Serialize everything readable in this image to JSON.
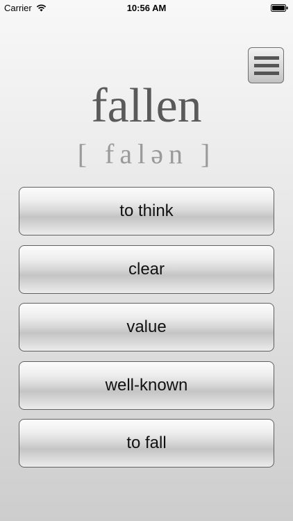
{
  "status_bar": {
    "carrier": "Carrier",
    "time": "10:56 AM",
    "wifi_icon": "wifi-icon",
    "battery_icon": "battery-icon"
  },
  "menu_button": {
    "icon": "hamburger-menu-icon"
  },
  "word": {
    "text": "fallen",
    "transcription": "[ falən ]"
  },
  "answers": [
    {
      "label": "to think"
    },
    {
      "label": "clear"
    },
    {
      "label": "value"
    },
    {
      "label": "well-known"
    },
    {
      "label": "to fall"
    }
  ],
  "colors": {
    "word": "#5a5a5a",
    "transcription": "#9a9a9a",
    "button_border": "#5f5f5f"
  }
}
